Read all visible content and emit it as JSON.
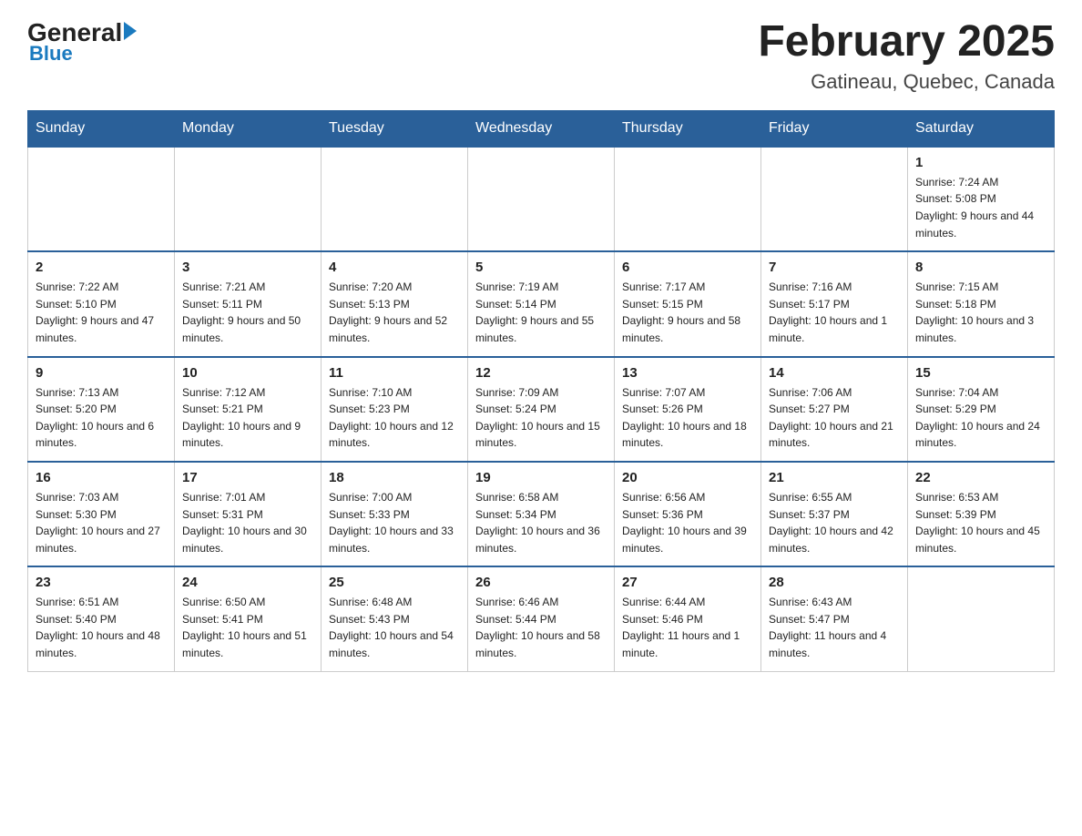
{
  "header": {
    "logo_text_general": "General",
    "logo_text_blue": "Blue",
    "month_title": "February 2025",
    "location": "Gatineau, Quebec, Canada"
  },
  "weekdays": [
    "Sunday",
    "Monday",
    "Tuesday",
    "Wednesday",
    "Thursday",
    "Friday",
    "Saturday"
  ],
  "weeks": [
    [
      {
        "day": "",
        "sunrise": "",
        "sunset": "",
        "daylight": "",
        "empty": true
      },
      {
        "day": "",
        "sunrise": "",
        "sunset": "",
        "daylight": "",
        "empty": true
      },
      {
        "day": "",
        "sunrise": "",
        "sunset": "",
        "daylight": "",
        "empty": true
      },
      {
        "day": "",
        "sunrise": "",
        "sunset": "",
        "daylight": "",
        "empty": true
      },
      {
        "day": "",
        "sunrise": "",
        "sunset": "",
        "daylight": "",
        "empty": true
      },
      {
        "day": "",
        "sunrise": "",
        "sunset": "",
        "daylight": "",
        "empty": true
      },
      {
        "day": "1",
        "sunrise": "Sunrise: 7:24 AM",
        "sunset": "Sunset: 5:08 PM",
        "daylight": "Daylight: 9 hours and 44 minutes.",
        "empty": false
      }
    ],
    [
      {
        "day": "2",
        "sunrise": "Sunrise: 7:22 AM",
        "sunset": "Sunset: 5:10 PM",
        "daylight": "Daylight: 9 hours and 47 minutes.",
        "empty": false
      },
      {
        "day": "3",
        "sunrise": "Sunrise: 7:21 AM",
        "sunset": "Sunset: 5:11 PM",
        "daylight": "Daylight: 9 hours and 50 minutes.",
        "empty": false
      },
      {
        "day": "4",
        "sunrise": "Sunrise: 7:20 AM",
        "sunset": "Sunset: 5:13 PM",
        "daylight": "Daylight: 9 hours and 52 minutes.",
        "empty": false
      },
      {
        "day": "5",
        "sunrise": "Sunrise: 7:19 AM",
        "sunset": "Sunset: 5:14 PM",
        "daylight": "Daylight: 9 hours and 55 minutes.",
        "empty": false
      },
      {
        "day": "6",
        "sunrise": "Sunrise: 7:17 AM",
        "sunset": "Sunset: 5:15 PM",
        "daylight": "Daylight: 9 hours and 58 minutes.",
        "empty": false
      },
      {
        "day": "7",
        "sunrise": "Sunrise: 7:16 AM",
        "sunset": "Sunset: 5:17 PM",
        "daylight": "Daylight: 10 hours and 1 minute.",
        "empty": false
      },
      {
        "day": "8",
        "sunrise": "Sunrise: 7:15 AM",
        "sunset": "Sunset: 5:18 PM",
        "daylight": "Daylight: 10 hours and 3 minutes.",
        "empty": false
      }
    ],
    [
      {
        "day": "9",
        "sunrise": "Sunrise: 7:13 AM",
        "sunset": "Sunset: 5:20 PM",
        "daylight": "Daylight: 10 hours and 6 minutes.",
        "empty": false
      },
      {
        "day": "10",
        "sunrise": "Sunrise: 7:12 AM",
        "sunset": "Sunset: 5:21 PM",
        "daylight": "Daylight: 10 hours and 9 minutes.",
        "empty": false
      },
      {
        "day": "11",
        "sunrise": "Sunrise: 7:10 AM",
        "sunset": "Sunset: 5:23 PM",
        "daylight": "Daylight: 10 hours and 12 minutes.",
        "empty": false
      },
      {
        "day": "12",
        "sunrise": "Sunrise: 7:09 AM",
        "sunset": "Sunset: 5:24 PM",
        "daylight": "Daylight: 10 hours and 15 minutes.",
        "empty": false
      },
      {
        "day": "13",
        "sunrise": "Sunrise: 7:07 AM",
        "sunset": "Sunset: 5:26 PM",
        "daylight": "Daylight: 10 hours and 18 minutes.",
        "empty": false
      },
      {
        "day": "14",
        "sunrise": "Sunrise: 7:06 AM",
        "sunset": "Sunset: 5:27 PM",
        "daylight": "Daylight: 10 hours and 21 minutes.",
        "empty": false
      },
      {
        "day": "15",
        "sunrise": "Sunrise: 7:04 AM",
        "sunset": "Sunset: 5:29 PM",
        "daylight": "Daylight: 10 hours and 24 minutes.",
        "empty": false
      }
    ],
    [
      {
        "day": "16",
        "sunrise": "Sunrise: 7:03 AM",
        "sunset": "Sunset: 5:30 PM",
        "daylight": "Daylight: 10 hours and 27 minutes.",
        "empty": false
      },
      {
        "day": "17",
        "sunrise": "Sunrise: 7:01 AM",
        "sunset": "Sunset: 5:31 PM",
        "daylight": "Daylight: 10 hours and 30 minutes.",
        "empty": false
      },
      {
        "day": "18",
        "sunrise": "Sunrise: 7:00 AM",
        "sunset": "Sunset: 5:33 PM",
        "daylight": "Daylight: 10 hours and 33 minutes.",
        "empty": false
      },
      {
        "day": "19",
        "sunrise": "Sunrise: 6:58 AM",
        "sunset": "Sunset: 5:34 PM",
        "daylight": "Daylight: 10 hours and 36 minutes.",
        "empty": false
      },
      {
        "day": "20",
        "sunrise": "Sunrise: 6:56 AM",
        "sunset": "Sunset: 5:36 PM",
        "daylight": "Daylight: 10 hours and 39 minutes.",
        "empty": false
      },
      {
        "day": "21",
        "sunrise": "Sunrise: 6:55 AM",
        "sunset": "Sunset: 5:37 PM",
        "daylight": "Daylight: 10 hours and 42 minutes.",
        "empty": false
      },
      {
        "day": "22",
        "sunrise": "Sunrise: 6:53 AM",
        "sunset": "Sunset: 5:39 PM",
        "daylight": "Daylight: 10 hours and 45 minutes.",
        "empty": false
      }
    ],
    [
      {
        "day": "23",
        "sunrise": "Sunrise: 6:51 AM",
        "sunset": "Sunset: 5:40 PM",
        "daylight": "Daylight: 10 hours and 48 minutes.",
        "empty": false
      },
      {
        "day": "24",
        "sunrise": "Sunrise: 6:50 AM",
        "sunset": "Sunset: 5:41 PM",
        "daylight": "Daylight: 10 hours and 51 minutes.",
        "empty": false
      },
      {
        "day": "25",
        "sunrise": "Sunrise: 6:48 AM",
        "sunset": "Sunset: 5:43 PM",
        "daylight": "Daylight: 10 hours and 54 minutes.",
        "empty": false
      },
      {
        "day": "26",
        "sunrise": "Sunrise: 6:46 AM",
        "sunset": "Sunset: 5:44 PM",
        "daylight": "Daylight: 10 hours and 58 minutes.",
        "empty": false
      },
      {
        "day": "27",
        "sunrise": "Sunrise: 6:44 AM",
        "sunset": "Sunset: 5:46 PM",
        "daylight": "Daylight: 11 hours and 1 minute.",
        "empty": false
      },
      {
        "day": "28",
        "sunrise": "Sunrise: 6:43 AM",
        "sunset": "Sunset: 5:47 PM",
        "daylight": "Daylight: 11 hours and 4 minutes.",
        "empty": false
      },
      {
        "day": "",
        "sunrise": "",
        "sunset": "",
        "daylight": "",
        "empty": true
      }
    ]
  ]
}
